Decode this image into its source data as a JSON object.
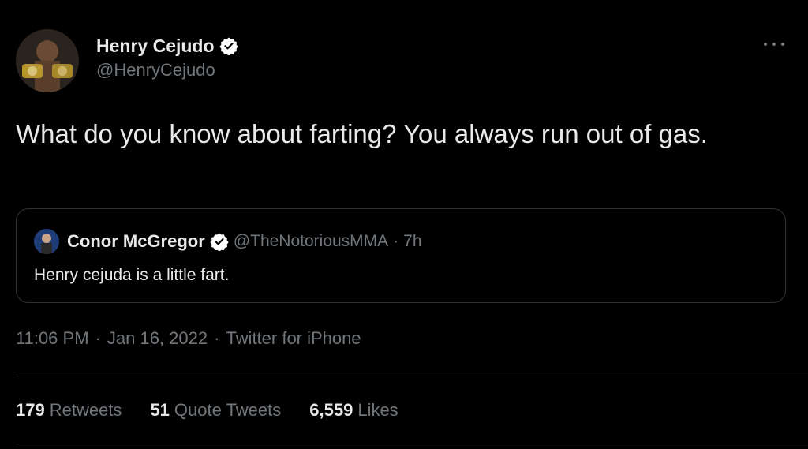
{
  "tweet": {
    "author": {
      "name": "Henry Cejudo",
      "handle": "@HenryCejudo",
      "verified": true
    },
    "text": "What do you know about farting? You always run out of gas.",
    "quoted": {
      "author_name": "Conor McGregor",
      "author_handle": "@TheNotoriousMMA",
      "separator": "·",
      "time": "7h",
      "text": "Henry cejuda is a little fart.",
      "verified": true
    },
    "meta": {
      "time": "11:06 PM",
      "separator": "·",
      "date": "Jan 16, 2022",
      "source": "Twitter for iPhone"
    },
    "stats": {
      "retweets": {
        "count": "179",
        "label": "Retweets"
      },
      "quote_tweets": {
        "count": "51",
        "label": "Quote Tweets"
      },
      "likes": {
        "count": "6,559",
        "label": "Likes"
      }
    }
  },
  "colors": {
    "background": "#000000",
    "primary_text": "#e7e9ea",
    "secondary_text": "#71767b",
    "border": "#2f3336",
    "verified_badge": "#ffffff"
  },
  "icons": {
    "verified": "verified-badge-icon",
    "more": "more-options-icon"
  }
}
